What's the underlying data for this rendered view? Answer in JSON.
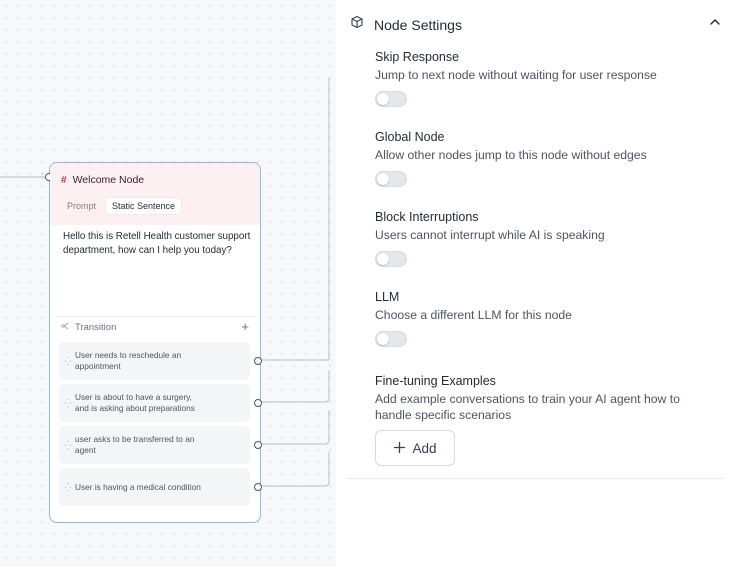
{
  "canvas": {
    "node": {
      "title": "Welcome Node",
      "tabs": [
        "Prompt",
        "Static Sentence"
      ],
      "active_tab": "Static Sentence",
      "text": "Hello this is Retell Health customer support department, how can I help you today?",
      "transition_label": "Transition",
      "transitions": [
        "User needs to reschedule an appointment",
        "User is about to have a surgery, and is asking about preparations",
        "user asks to be transferred to an agent",
        "User is having a medical condition"
      ]
    }
  },
  "panel": {
    "title": "Node Settings",
    "settings": [
      {
        "label": "Skip Response",
        "description": "Jump to next node without waiting for user response",
        "enabled": false
      },
      {
        "label": "Global Node",
        "description": "Allow other nodes jump to this node without edges",
        "enabled": false
      },
      {
        "label": "Block Interruptions",
        "description": "Users cannot interrupt while AI is speaking",
        "enabled": false
      },
      {
        "label": "LLM",
        "description": "Choose a different LLM for this node",
        "enabled": false
      }
    ],
    "fine_tuning": {
      "label": "Fine-tuning Examples",
      "description": "Add example conversations to train your AI agent how to handle specific scenarios",
      "add_label": "Add"
    }
  },
  "icons": {
    "panel": "cube-icon",
    "collapse": "chevron-up-icon",
    "transition": "branch-icon",
    "add": "plus-icon",
    "condition": "sparkle-icon"
  },
  "colors": {
    "node_border": "#93b6e6",
    "node_header": "#fdf0f3",
    "node_hash": "#b1365f",
    "canvas_bg": "#f7f8fa"
  }
}
